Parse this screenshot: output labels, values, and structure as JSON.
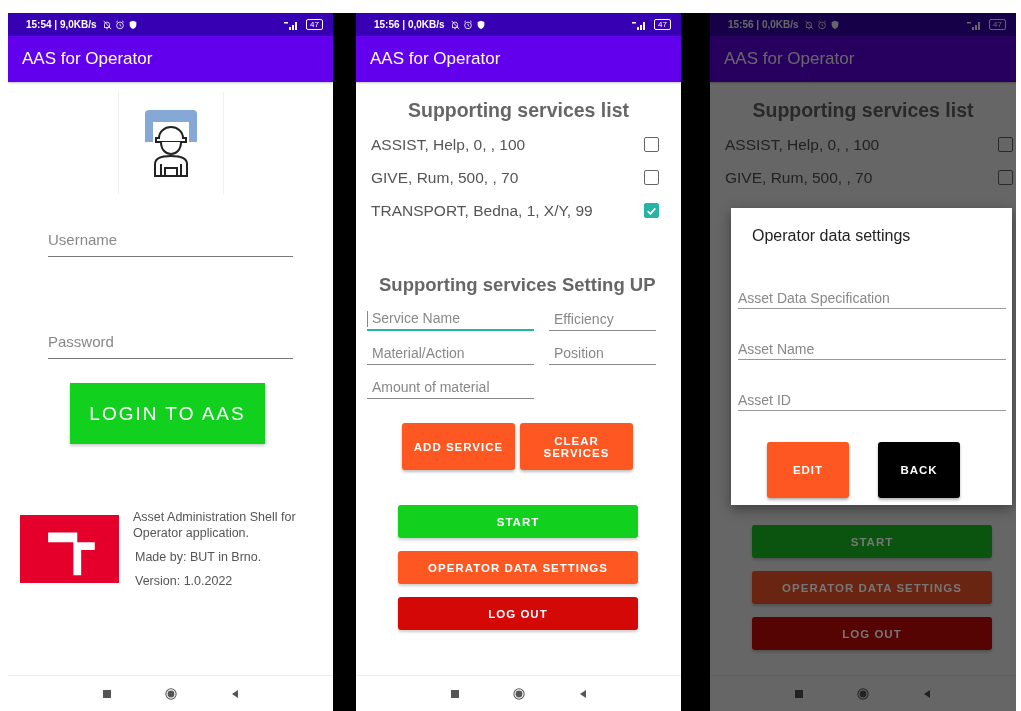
{
  "screens": [
    {
      "kind": "login",
      "dimmed": false,
      "status_bar": {
        "text": "15:54 | 9,0KB/s",
        "battery": "47"
      },
      "title": "AAS for Operator",
      "fields": [
        {
          "placeholder": "Username"
        },
        {
          "placeholder": "Password"
        }
      ],
      "login_button": "LOGIN TO AAS",
      "about": [
        "Asset Administration Shell for Operator application.",
        "Made by: BUT in Brno.",
        "Version: 1.0.2022"
      ]
    },
    {
      "kind": "services",
      "dimmed": false,
      "status_bar": {
        "text": "15:56 | 0,0KB/s",
        "battery": "47"
      },
      "title": "AAS for Operator",
      "list_title": "Supporting services list",
      "services": [
        {
          "label": "ASSIST, Help, 0, , 100",
          "checked": false
        },
        {
          "label": "GIVE, Rum, 500, , 70",
          "checked": false
        },
        {
          "label": "TRANSPORT, Bedna, 1, X/Y, 99",
          "checked": true
        }
      ],
      "setup_title": "Supporting services Setting UP",
      "setup_fields": [
        {
          "placeholder": "Service Name",
          "focused": true
        },
        {
          "placeholder": "Efficiency",
          "focused": false
        },
        {
          "placeholder": "Material/Action",
          "focused": false
        },
        {
          "placeholder": "Position",
          "focused": false
        },
        {
          "placeholder": "Amount of material",
          "focused": false
        }
      ],
      "service_buttons": [
        "ADD SERVICE",
        "CLEAR SERVICES"
      ],
      "actions": [
        {
          "label": "START",
          "color": "#11d11e"
        },
        {
          "label": "OPERATOR DATA SETTINGS",
          "color": "#ff5722"
        },
        {
          "label": "LOG OUT",
          "color": "#d50808"
        }
      ]
    },
    {
      "kind": "dialog",
      "dimmed": true,
      "status_bar": {
        "text": "15:56 | 0,0KB/s",
        "battery": "47"
      },
      "title": "AAS for Operator",
      "list_title": "Supporting services list",
      "services": [
        {
          "label": "ASSIST, Help, 0, , 100",
          "checked": false
        },
        {
          "label": "GIVE, Rum, 500, , 70",
          "checked": false
        }
      ],
      "actions": [
        {
          "label": "START",
          "color": "#0b540f"
        },
        {
          "label": "OPERATOR DATA SETTINGS",
          "color": "#6a2512"
        },
        {
          "label": "LOG OUT",
          "color": "#560303"
        }
      ],
      "dialog": {
        "title": "Operator data settings",
        "fields": [
          {
            "placeholder": "Asset Data Specification"
          },
          {
            "placeholder": "Asset Name"
          },
          {
            "placeholder": "Asset ID"
          }
        ],
        "buttons": [
          {
            "label": "EDIT",
            "kind": "primary"
          },
          {
            "label": "BACK",
            "kind": "secondary"
          }
        ]
      }
    }
  ]
}
